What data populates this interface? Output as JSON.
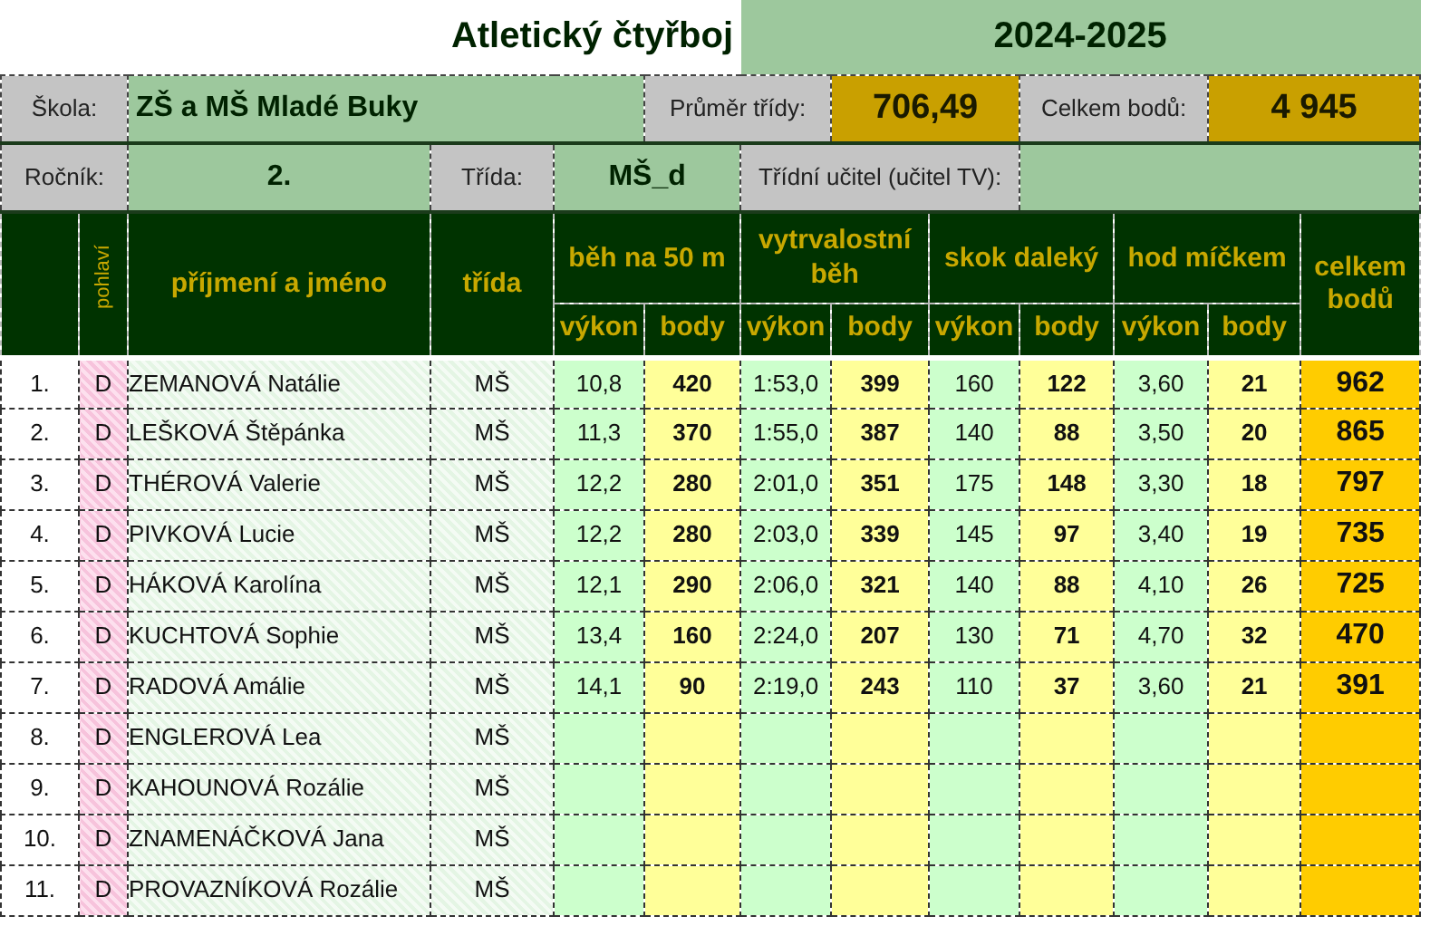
{
  "title": "Atletický čtyřboj",
  "year": "2024-2025",
  "info": {
    "school_label": "Škola:",
    "school": "ZŠ a MŠ Mladé Buky",
    "average_label": "Průměr třídy:",
    "average": "706,49",
    "total_label": "Celkem bodů:",
    "total": "4 945",
    "grade_label": "Ročník:",
    "grade": "2.",
    "class_label": "Třída:",
    "class": "MŠ_d",
    "teacher_label": "Třídní učitel (učitel TV):"
  },
  "table": {
    "columns": {
      "gender": "pohlaví",
      "name": "příjmení a jméno",
      "class": "třída",
      "total": "celkem bodů"
    },
    "events": [
      {
        "name": "běh na 50 m",
        "performance": "výkon",
        "points": "body"
      },
      {
        "name": "vytrvalostní běh",
        "performance": "výkon",
        "points": "body"
      },
      {
        "name": "skok daleký",
        "performance": "výkon",
        "points": "body"
      },
      {
        "name": "hod míčkem",
        "performance": "výkon",
        "points": "body"
      }
    ],
    "rows": [
      {
        "number": "1.",
        "gender": "D",
        "name": "ZEMANOVÁ Natálie",
        "class": "MŠ",
        "results": [
          [
            "10,8",
            "420"
          ],
          [
            "1:53,0",
            "399"
          ],
          [
            "160",
            "122"
          ],
          [
            "3,60",
            "21"
          ]
        ],
        "total": "962"
      },
      {
        "number": "2.",
        "gender": "D",
        "name": "LEŠKOVÁ Štěpánka",
        "class": "MŠ",
        "results": [
          [
            "11,3",
            "370"
          ],
          [
            "1:55,0",
            "387"
          ],
          [
            "140",
            "88"
          ],
          [
            "3,50",
            "20"
          ]
        ],
        "total": "865"
      },
      {
        "number": "3.",
        "gender": "D",
        "name": "THÉROVÁ Valerie",
        "class": "MŠ",
        "results": [
          [
            "12,2",
            "280"
          ],
          [
            "2:01,0",
            "351"
          ],
          [
            "175",
            "148"
          ],
          [
            "3,30",
            "18"
          ]
        ],
        "total": "797"
      },
      {
        "number": "4.",
        "gender": "D",
        "name": "PIVKOVÁ Lucie",
        "class": "MŠ",
        "results": [
          [
            "12,2",
            "280"
          ],
          [
            "2:03,0",
            "339"
          ],
          [
            "145",
            "97"
          ],
          [
            "3,40",
            "19"
          ]
        ],
        "total": "735"
      },
      {
        "number": "5.",
        "gender": "D",
        "name": "HÁKOVÁ Karolína",
        "class": "MŠ",
        "results": [
          [
            "12,1",
            "290"
          ],
          [
            "2:06,0",
            "321"
          ],
          [
            "140",
            "88"
          ],
          [
            "4,10",
            "26"
          ]
        ],
        "total": "725"
      },
      {
        "number": "6.",
        "gender": "D",
        "name": "KUCHTOVÁ Sophie",
        "class": "MŠ",
        "results": [
          [
            "13,4",
            "160"
          ],
          [
            "2:24,0",
            "207"
          ],
          [
            "130",
            "71"
          ],
          [
            "4,70",
            "32"
          ]
        ],
        "total": "470"
      },
      {
        "number": "7.",
        "gender": "D",
        "name": "RADOVÁ Amálie",
        "class": "MŠ",
        "results": [
          [
            "14,1",
            "90"
          ],
          [
            "2:19,0",
            "243"
          ],
          [
            "110",
            "37"
          ],
          [
            "3,60",
            "21"
          ]
        ],
        "total": "391"
      },
      {
        "number": "8.",
        "gender": "D",
        "name": "ENGLEROVÁ Lea",
        "class": "MŠ"
      },
      {
        "number": "9.",
        "gender": "D",
        "name": "KAHOUNOVÁ Rozálie",
        "class": "MŠ"
      },
      {
        "number": "10.",
        "gender": "D",
        "name": "ZNAMENÁČKOVÁ Jana",
        "class": "MŠ"
      },
      {
        "number": "11.",
        "gender": "D",
        "name": "PROVAZNÍKOVÁ Rozálie",
        "class": "MŠ"
      }
    ]
  }
}
